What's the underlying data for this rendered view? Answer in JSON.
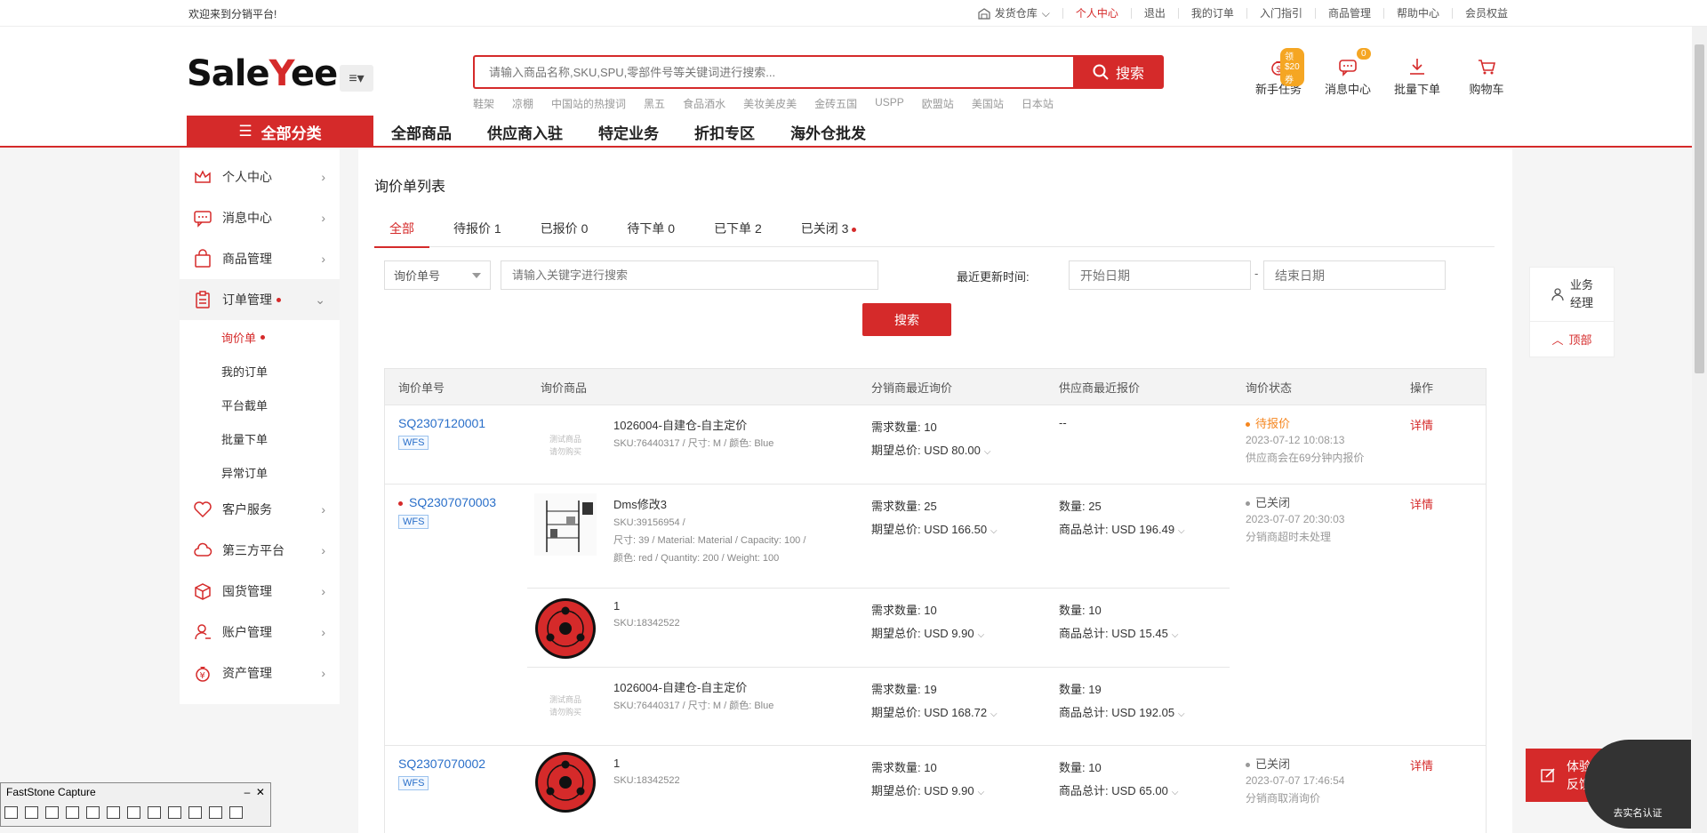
{
  "topbar": {
    "welcome": "欢迎来到分销平台!",
    "warehouse": "发货仓库",
    "links": [
      "个人中心",
      "退出",
      "我的订单",
      "入门指引",
      "商品管理",
      "帮助中心",
      "会员权益"
    ]
  },
  "header": {
    "logo_pre": "Sale",
    "logo_y": "Y",
    "logo_post": "ee",
    "search_placeholder": "请输入商品名称,SKU,SPU,零部件号等关键词进行搜索...",
    "search_button": "搜索",
    "hotwords": [
      "鞋架",
      "凉棚",
      "中国站的热搜词",
      "黑五",
      "食品酒水",
      "美妆美皮美",
      "金砖五国",
      "USPP",
      "欧盟站",
      "美国站",
      "日本站"
    ],
    "icons": [
      {
        "label": "新手任务",
        "badge": "领$20券"
      },
      {
        "label": "消息中心",
        "badge": "0"
      },
      {
        "label": "批量下单",
        "badge": ""
      },
      {
        "label": "购物车",
        "badge": ""
      }
    ],
    "all_categories": "全部分类",
    "nav": [
      "全部商品",
      "供应商入驻",
      "特定业务",
      "折扣专区",
      "海外仓批发"
    ]
  },
  "sidebar": {
    "items": [
      {
        "label": "个人中心"
      },
      {
        "label": "消息中心"
      },
      {
        "label": "商品管理"
      },
      {
        "label": "订单管理"
      },
      {
        "label": "客户服务"
      },
      {
        "label": "第三方平台"
      },
      {
        "label": "囤货管理"
      },
      {
        "label": "账户管理"
      },
      {
        "label": "资产管理"
      }
    ],
    "subitems": [
      "询价单",
      "我的订单",
      "平台截单",
      "批量下单",
      "异常订单"
    ]
  },
  "main": {
    "title": "询价单列表",
    "tabs": [
      {
        "label": "全部"
      },
      {
        "label": "待报价 1"
      },
      {
        "label": "已报价 0"
      },
      {
        "label": "待下单 0"
      },
      {
        "label": "已下单 2"
      },
      {
        "label": "已关闭  3"
      }
    ],
    "filter": {
      "select_value": "询价单号",
      "keyword_placeholder": "请输入关键字进行搜索",
      "date_label": "最近更新时间:",
      "start_placeholder": "开始日期",
      "end_placeholder": "结束日期",
      "separator": "-",
      "search_button": "搜索"
    },
    "columns": [
      "询价单号",
      "询价商品",
      "分销商最近询价",
      "供应商最近报价",
      "询价状态",
      "操作"
    ],
    "placeholder_img": [
      "测试商品",
      "请勿购买"
    ],
    "rows": [
      {
        "id": "SQ2307120001",
        "tag": "WFS",
        "status": "待报价",
        "status_time": "2023-07-12 10:08:13",
        "status_note": "供应商会在69分钟内报价",
        "action": "详情",
        "products": [
          {
            "title": "1026004-自建仓-自主定价",
            "sku": "SKU:76440317 / 尺寸: M / 颜色: Blue",
            "sku2": "",
            "sku3": "",
            "qty": "需求数量: 10",
            "total": "期望总价: USD 80.00",
            "sqty": "--",
            "stotal": ""
          }
        ]
      },
      {
        "id": "SQ2307070003",
        "tag": "WFS",
        "status": "已关闭",
        "status_time": "2023-07-07 20:30:03",
        "status_note": "分销商超时未处理",
        "action": "详情",
        "products": [
          {
            "title": "Dms修改3",
            "sku": "SKU:39156954 /",
            "sku2": "尺寸: 39 / Material: Material / Capacity: 100 /",
            "sku3": "颜色: red / Quantity: 200 / Weight: 100",
            "qty": "需求数量: 25",
            "total": "期望总价: USD 166.50",
            "sqty": "数量: 25",
            "stotal": "商品总计: USD 196.49"
          },
          {
            "title": "1",
            "sku": "SKU:18342522",
            "sku2": "",
            "sku3": "",
            "qty": "需求数量: 10",
            "total": "期望总价: USD 9.90",
            "sqty": "数量: 10",
            "stotal": "商品总计: USD 15.45"
          },
          {
            "title": "1026004-自建仓-自主定价",
            "sku": "SKU:76440317 / 尺寸: M / 颜色: Blue",
            "sku2": "",
            "sku3": "",
            "qty": "需求数量: 19",
            "total": "期望总价: USD 168.72",
            "sqty": "数量: 19",
            "stotal": "商品总计: USD 192.05"
          }
        ]
      },
      {
        "id": "SQ2307070002",
        "tag": "WFS",
        "status": "已关闭",
        "status_time": "2023-07-07 17:46:54",
        "status_note": "分销商取消询价",
        "action": "详情",
        "products": [
          {
            "title": "1",
            "sku": "SKU:18342522",
            "sku2": "",
            "sku3": "",
            "qty": "需求数量: 10",
            "total": "期望总价: USD 9.90",
            "sqty": "数量: 10",
            "stotal": "商品总计: USD 65.00"
          }
        ]
      }
    ]
  },
  "float": {
    "manager": "业务\n经理",
    "top": "顶部",
    "feedback": "体验\n反馈",
    "verify": "去实名认证"
  },
  "faststone": {
    "title": "FastStone Capture"
  },
  "colors": {
    "brand": "#d52a2a",
    "link": "#2a6fc9",
    "pending": "#f5861f",
    "closed": "#999999"
  }
}
